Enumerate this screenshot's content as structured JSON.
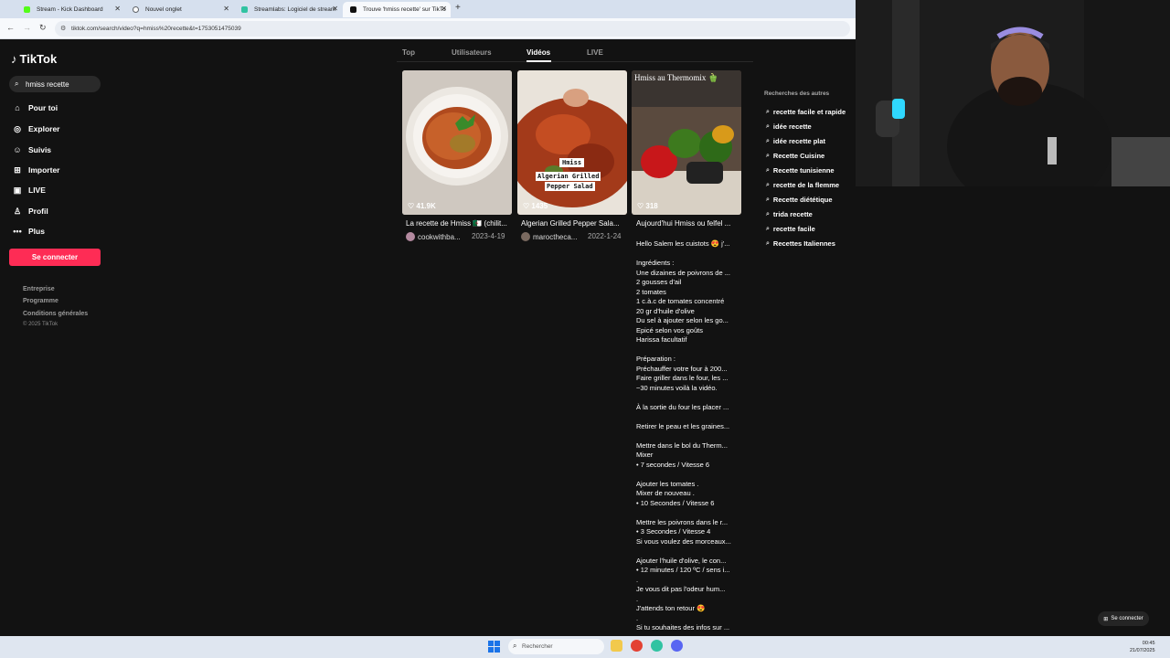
{
  "browser": {
    "tabs": [
      {
        "title": "Stream - Kick Dashboard",
        "color": "#53fc18"
      },
      {
        "title": "Nouvel onglet",
        "color": "#5f6368"
      },
      {
        "title": "Streamlabs: Logiciel de stream",
        "color": "#31c3a2"
      },
      {
        "title": "Trouve 'hmiss recette' sur TikTo",
        "color": "#111111"
      }
    ],
    "new_tab": "+",
    "url": "tiktok.com/search/video?q=hmiss%20recette&t=1753051475039"
  },
  "sidebar": {
    "logo": "TikTok",
    "search_value": "hmiss recette",
    "nav": [
      {
        "label": "Pour toi",
        "icon": "home-icon"
      },
      {
        "label": "Explorer",
        "icon": "compass-icon"
      },
      {
        "label": "Suivis",
        "icon": "following-icon"
      },
      {
        "label": "Importer",
        "icon": "upload-icon"
      },
      {
        "label": "LIVE",
        "icon": "live-icon"
      },
      {
        "label": "Profil",
        "icon": "profile-icon"
      },
      {
        "label": "Plus",
        "icon": "more-icon"
      }
    ],
    "login": "Se connecter",
    "footer": [
      "Entreprise",
      "Programme",
      "Conditions générales"
    ],
    "copyright": "© 2025 TikTok"
  },
  "search_tabs": [
    "Top",
    "Utilisateurs",
    "Vidéos",
    "LIVE"
  ],
  "videos": [
    {
      "likes": "41.9K",
      "title": "La recette de Hmiss 🇩🇿 (chilit...",
      "author": "cookwithba...",
      "date": "2023-4-19"
    },
    {
      "likes": "1435",
      "title": "Algerian Grilled Pepper Sala...",
      "author": "marocthеca...",
      "date": "2022-1-24",
      "overlay_1": "Hmiss",
      "overlay_2": "Algerian Grilled",
      "overlay_3": "Pepper Salad"
    },
    {
      "likes": "318",
      "title": "Aujourd'hui Hmiss ou felfel ...",
      "overlay_top": "Hmiss au Thermomix 🫑"
    }
  ],
  "description": [
    "Hello Salem les cuistots 😍 j'...",
    "",
    "Ingrédients :",
    "Une dizaines de poivrons de ...",
    "2 gousses d'ail",
    "2 tomates",
    "1 c.à.c de tomates concentré",
    "20 gr d'huile d'olive",
    "Du sel à ajouter selon les go...",
    "Epicé selon vos goûts",
    "Harissa facultatif",
    "",
    "Préparation :",
    "Préchauffer votre four à 200...",
    "Faire griller dans le four, les ...",
    "~30 minutes voilà la vidéo.",
    "",
    "À la sortie du four les placer ...",
    "",
    "Retirer le peau et les graines...",
    "",
    "Mettre dans le bol du Therm...",
    "Mixer",
    "• 7 secondes / Vitesse 6",
    "",
    "Ajouter les tomates .",
    "Mixer de nouveau .",
    "• 10 Secondes / Vitesse 6",
    "",
    "Mettre les poivrons dans le r...",
    "• 3 Secondes / Vitesse 4",
    "Si vous voulez des morceaux...",
    "",
    "Ajouter l'huile d'olive, le con...",
    "• 12 minutes / 120 ºC / sens i...",
    ".",
    "Je vous dit pas l'odeur hum...",
    ".",
    "J'attends ton retour 😍",
    ".",
    "Si tu souhaites des infos sur ..."
  ],
  "related": {
    "heading": "Recherches des autres",
    "items": [
      "recette facile et rapide",
      "idée recette",
      "idée recette plat",
      "Recette Cuisine",
      "Recette tunisienne",
      "recette de la flemme",
      "Recette diététique",
      "trida recette",
      "recette facile",
      "Recettes Italiennes"
    ]
  },
  "floating_login": "Se connecter",
  "taskbar": {
    "search_placeholder": "Rechercher",
    "time": "00:45",
    "date": "21/07/2025"
  },
  "colors": {
    "accent": "#fe2c55",
    "page_bg": "#121212"
  }
}
